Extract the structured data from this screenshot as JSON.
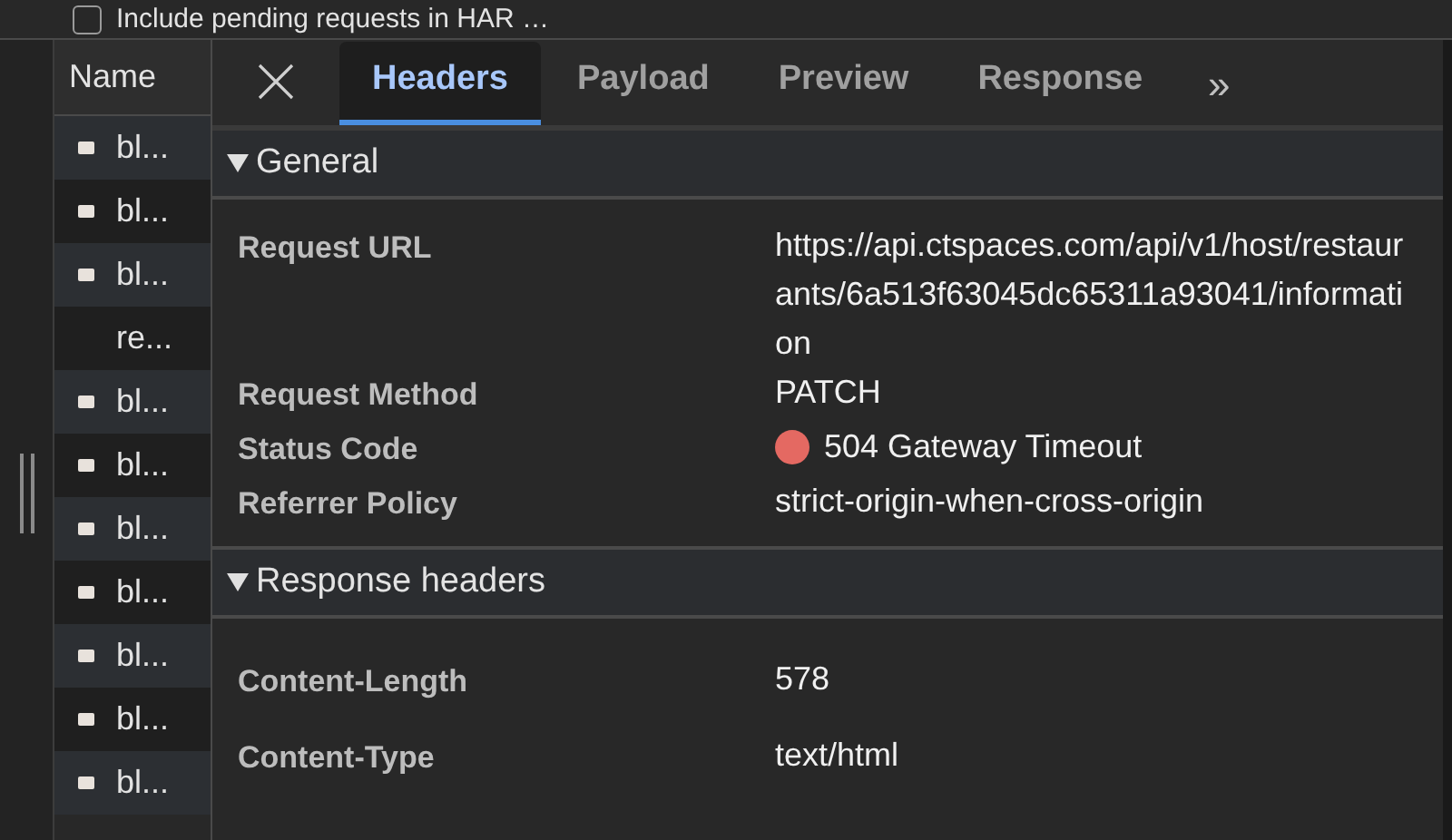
{
  "toolbar": {
    "option": {
      "label": "Include pending requests in HAR …",
      "checked": false
    }
  },
  "name_column": {
    "heading": "Name",
    "rows": [
      {
        "label": "bl...",
        "kind": "image"
      },
      {
        "label": "bl...",
        "kind": "image"
      },
      {
        "label": "bl...",
        "kind": "image"
      },
      {
        "label": "re...",
        "kind": "fetch"
      },
      {
        "label": "bl...",
        "kind": "image"
      },
      {
        "label": "bl...",
        "kind": "image"
      },
      {
        "label": "bl...",
        "kind": "image"
      },
      {
        "label": "bl...",
        "kind": "image"
      },
      {
        "label": "bl...",
        "kind": "image"
      },
      {
        "label": "bl...",
        "kind": "image"
      },
      {
        "label": "bl...",
        "kind": "image"
      }
    ]
  },
  "tabs": [
    {
      "label": "Headers",
      "selected": true
    },
    {
      "label": "Payload",
      "selected": false
    },
    {
      "label": "Preview",
      "selected": false
    },
    {
      "label": "Response",
      "selected": false
    }
  ],
  "more_tabs": "»",
  "sections": [
    {
      "title": "General",
      "expanded": true,
      "rows": [
        {
          "name": "Request URL",
          "value": "https://api.ctspaces.com/api/v1/host/restaurants/6a513f63045dc65311a93041/information"
        },
        {
          "name": "Request Method",
          "value": "PATCH"
        },
        {
          "name": "Status Code",
          "value": "504 Gateway Timeout",
          "color": "#e46962"
        },
        {
          "name": "Referrer Policy",
          "value": "strict-origin-when-cross-origin"
        }
      ]
    },
    {
      "title": "Response headers",
      "expanded": true,
      "rows": [
        {
          "name": "Content-Length",
          "value": "578"
        },
        {
          "name": "Content-Type",
          "value": "text/html"
        }
      ]
    }
  ]
}
